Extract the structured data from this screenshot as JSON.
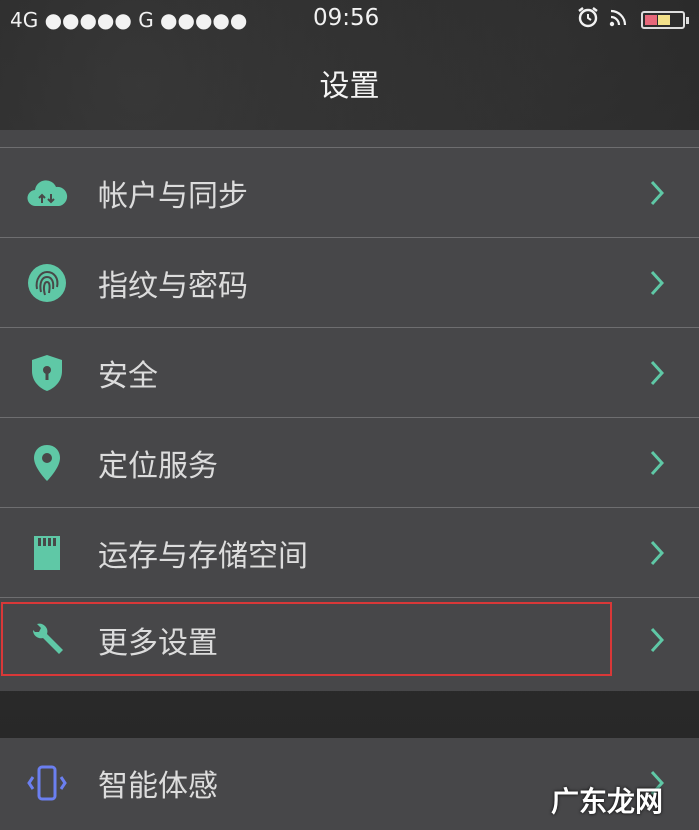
{
  "status": {
    "left": "4G ●●●●●  G ●●●●●",
    "time": "09:56",
    "icons": [
      "alarm-icon",
      "wifi-icon",
      "battery-icon"
    ]
  },
  "header": {
    "title": "设置"
  },
  "menu": {
    "items": [
      {
        "label": "帐户与同步",
        "icon": "cloud-sync-icon"
      },
      {
        "label": "指纹与密码",
        "icon": "fingerprint-icon"
      },
      {
        "label": "安全",
        "icon": "shield-icon"
      },
      {
        "label": "定位服务",
        "icon": "location-pin-icon"
      },
      {
        "label": "运存与存储空间",
        "icon": "memory-card-icon"
      },
      {
        "label": "更多设置",
        "icon": "wrench-icon",
        "highlighted": true
      }
    ],
    "items2": [
      {
        "label": "智能体感",
        "icon": "phone-motion-icon"
      }
    ]
  },
  "colors": {
    "accent": "#5fc8a6",
    "accent_blue": "#6b7ff0",
    "highlight": "#d93838"
  },
  "watermark": "广东龙网"
}
